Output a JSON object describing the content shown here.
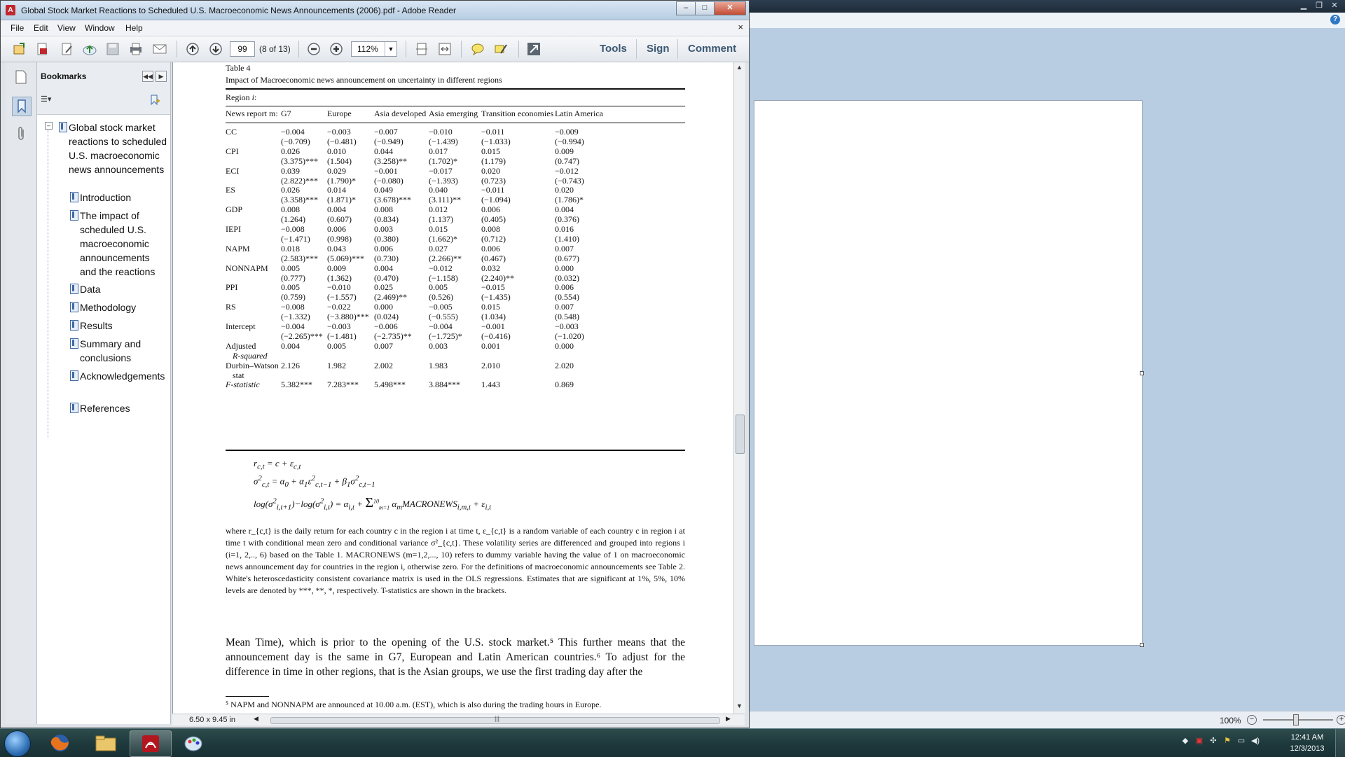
{
  "window": {
    "title": "Global Stock Market Reactions to Scheduled U.S. Macroeconomic News Announcements (2006).pdf - Adobe Reader",
    "min": "–",
    "max": "□",
    "close": "✕"
  },
  "menu": {
    "items": [
      "File",
      "Edit",
      "View",
      "Window",
      "Help"
    ],
    "close": "×"
  },
  "toolbar": {
    "page_number": "99",
    "page_of": "(8 of 13)",
    "zoom": "112%",
    "zoom_dropdown": "▼",
    "tools": "Tools",
    "sign": "Sign",
    "comment": "Comment"
  },
  "bookmarks": {
    "title": "Bookmarks",
    "collapse_all": "◀◀",
    "expand": "▶",
    "options": "☰▾",
    "tree_toggle": "–",
    "items": [
      "Global stock market reactions to scheduled U.S. macroeconomic news announcements",
      "Introduction",
      "The impact of scheduled U.S. macroeconomic announcements and the reactions",
      "Data",
      "Methodology",
      "Results",
      "Summary and conclusions",
      "Acknowledgements",
      "References"
    ]
  },
  "document": {
    "table_label": "Table 4",
    "table_caption": "Impact of Macroeconomic news announcement on uncertainty in different regions",
    "region_label": "Region i:",
    "columns": [
      "News report m:",
      "G7",
      "Europe",
      "Asia developed",
      "Asia emerging",
      "Transition economies",
      "Latin America"
    ],
    "rows": [
      {
        "label": "CC",
        "coef": [
          "−0.004",
          "−0.003",
          "−0.007",
          "−0.010",
          "−0.011",
          "−0.009"
        ],
        "t": [
          "(−0.709)",
          "(−0.481)",
          "(−0.949)",
          "(−1.439)",
          "(−1.033)",
          "(−0.994)"
        ]
      },
      {
        "label": "CPI",
        "coef": [
          "0.026",
          "0.010",
          "0.044",
          "0.017",
          "0.015",
          "0.009"
        ],
        "t": [
          "(3.375)***",
          "(1.504)",
          "(3.258)**",
          "(1.702)*",
          "(1.179)",
          "(0.747)"
        ]
      },
      {
        "label": "ECI",
        "coef": [
          "0.039",
          "0.029",
          "−0.001",
          "−0.017",
          "0.020",
          "−0.012"
        ],
        "t": [
          "(2.822)***",
          "(1.790)*",
          "(−0.080)",
          "(−1.393)",
          "(0.723)",
          "(−0.743)"
        ]
      },
      {
        "label": "ES",
        "coef": [
          "0.026",
          "0.014",
          "0.049",
          "0.040",
          "−0.011",
          "0.020"
        ],
        "t": [
          "(3.358)***",
          "(1.871)*",
          "(3.678)***",
          "(3.111)**",
          "(−1.094)",
          "(1.786)*"
        ]
      },
      {
        "label": "GDP",
        "coef": [
          "0.008",
          "0.004",
          "0.008",
          "0.012",
          "0.006",
          "0.004"
        ],
        "t": [
          "(1.264)",
          "(0.607)",
          "(0.834)",
          "(1.137)",
          "(0.405)",
          "(0.376)"
        ]
      },
      {
        "label": "IEPI",
        "coef": [
          "−0.008",
          "0.006",
          "0.003",
          "0.015",
          "0.008",
          "0.016"
        ],
        "t": [
          "(−1.471)",
          "(0.998)",
          "(0.380)",
          "(1.662)*",
          "(0.712)",
          "(1.410)"
        ]
      },
      {
        "label": "NAPM",
        "coef": [
          "0.018",
          "0.043",
          "0.006",
          "0.027",
          "0.006",
          "0.007"
        ],
        "t": [
          "(2.583)***",
          "(5.069)***",
          "(0.730)",
          "(2.266)**",
          "(0.467)",
          "(0.677)"
        ]
      },
      {
        "label": "NONNAPM",
        "coef": [
          "0.005",
          "0.009",
          "0.004",
          "−0.012",
          "0.032",
          "0.000"
        ],
        "t": [
          "(0.777)",
          "(1.362)",
          "(0.470)",
          "(−1.158)",
          "(2.240)**",
          "(0.032)"
        ]
      },
      {
        "label": "PPI",
        "coef": [
          "0.005",
          "−0.010",
          "0.025",
          "0.005",
          "−0.015",
          "0.006"
        ],
        "t": [
          "(0.759)",
          "(−1.557)",
          "(2.469)**",
          "(0.526)",
          "(−1.435)",
          "(0.554)"
        ]
      },
      {
        "label": "RS",
        "coef": [
          "−0.008",
          "−0.022",
          "0.000",
          "−0.005",
          "0.015",
          "0.007"
        ],
        "t": [
          "(−1.332)",
          "(−3.880)***",
          "(0.024)",
          "(−0.555)",
          "(1.034)",
          "(0.548)"
        ]
      },
      {
        "label": "Intercept",
        "coef": [
          "−0.004",
          "−0.003",
          "−0.006",
          "−0.004",
          "−0.001",
          "−0.003"
        ],
        "t": [
          "(−2.265)***",
          "(−1.481)",
          "(−2.735)**",
          "(−1.725)*",
          "(−0.416)",
          "(−1.020)"
        ]
      }
    ],
    "adj_label": "Adjusted",
    "adj_label2": "R-squared",
    "adj_values": [
      "0.004",
      "0.005",
      "0.007",
      "0.003",
      "0.001",
      "0.000"
    ],
    "dw_label": "Durbin–Watson",
    "dw_label2": "stat",
    "dw_values": [
      "2.126",
      "1.982",
      "2.002",
      "1.983",
      "2.010",
      "2.020"
    ],
    "f_label": "F-statistic",
    "f_values": [
      "5.382***",
      "7.283***",
      "5.498***",
      "3.884***",
      "1.443",
      "0.869"
    ],
    "equations": [
      "r_{c,t} = c + ε_{c,t}",
      "σ²_{c,t} = α₀ + α₁ε²_{c,t−1} + β₁σ²_{c,t−1}",
      "log(σ²_{i,t+1})−log(σ²_{i,t}) = α_{i,t} + Σ_{m=1}^{10} α_m MACRONEWS_{i,m,t} + ε_{i,t}"
    ],
    "note": "where r_{c,t} is the daily return for each country c in the region i at time t, ε_{c,t} is a random variable of each country c in region i at time t with conditional mean zero and conditional variance σ²_{c,t}. These volatility series are differenced and grouped into regions i (i=1, 2,.., 6) based on the Table 1. MACRONEWS (m=1,2,..., 10) refers to dummy variable having the value of 1 on macroeconomic news announcement day for countries in the region i, otherwise zero. For the definitions of macroeconomic announcements see Table 2. White's heteroscedasticity consistent covariance matrix is used in the OLS regressions. Estimates that are significant at 1%, 5%, 10% levels are denoted by ***, **, *, respectively. T-statistics are shown in the brackets.",
    "body_text": "Mean Time), which is prior to the opening of the U.S. stock market.⁵ This further means that the announcement day is the same in G7, European and Latin American countries.⁶ To adjust for the difference in time in other regions, that is the Asian groups, we use the first trading day after the",
    "footnote": "⁵ NAPM and NONNAPM are announced at 10.00 a.m. (EST), which is also during the trading hours in Europe."
  },
  "statusbar": {
    "page_size": "6.50 x 9.45 in"
  },
  "background_window": {
    "zoom": "100%"
  },
  "taskbar": {
    "time": "12:41 AM",
    "date": "12/3/2013"
  }
}
